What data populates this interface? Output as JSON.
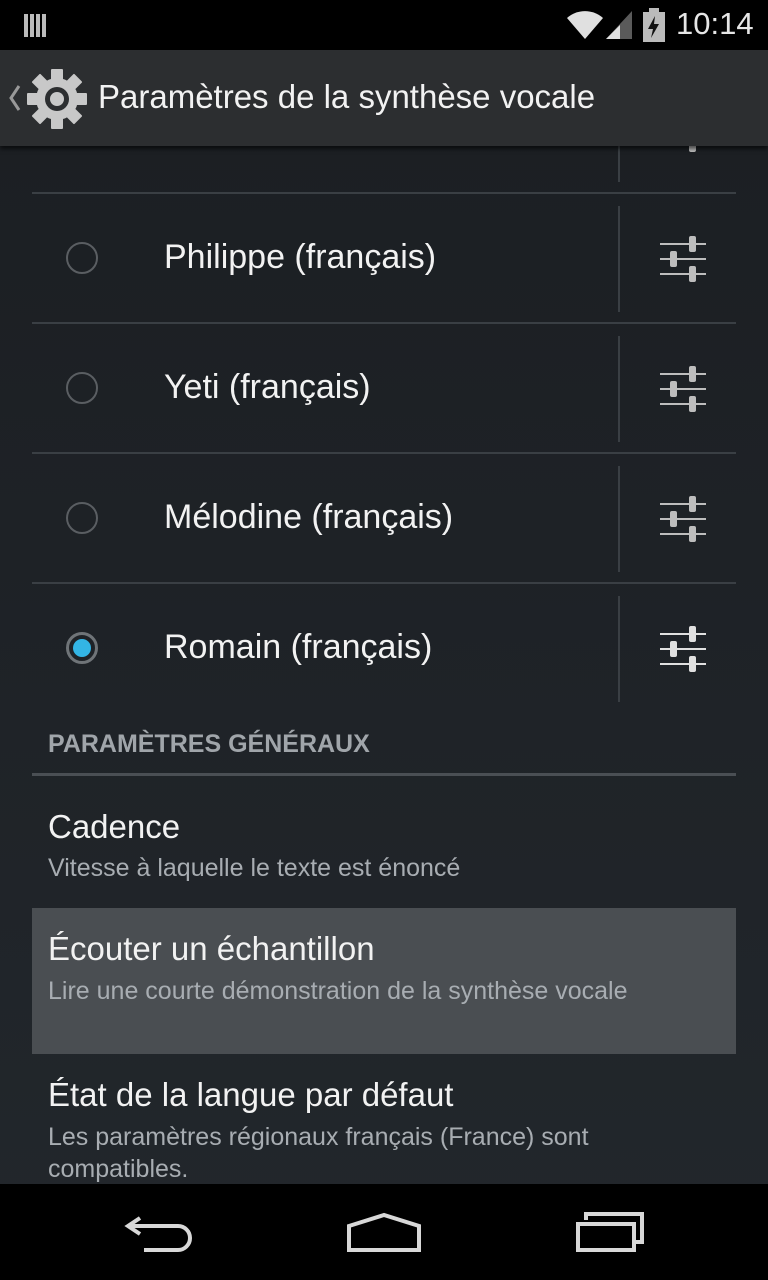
{
  "status_bar": {
    "time": "10:14",
    "icons": [
      "notification-icon",
      "wifi-icon",
      "cell-signal-icon",
      "battery-charging-icon"
    ]
  },
  "action_bar": {
    "title": "Paramètres de la synthèse vocale",
    "icons": [
      "back-caret-icon",
      "settings-gear-icon"
    ]
  },
  "voices": [
    {
      "label": "Philippe (français)",
      "selected": false
    },
    {
      "label": "Yeti (français)",
      "selected": false
    },
    {
      "label": "Mélodine (français)",
      "selected": false
    },
    {
      "label": "Romain (français)",
      "selected": true
    }
  ],
  "general": {
    "header": "PARAMÈTRES GÉNÉRAUX",
    "items": [
      {
        "title": "Cadence",
        "summary": "Vitesse à laquelle le texte est énoncé"
      },
      {
        "title": "Écouter un échantillon",
        "summary": "Lire une courte démonstration de la synthèse vocale"
      },
      {
        "title": "État de la langue par défaut",
        "summary": "Les paramètres régionaux français (France) sont compatibles."
      }
    ]
  },
  "nav_bar": {
    "icons": [
      "back-icon",
      "home-icon",
      "recent-apps-icon"
    ]
  },
  "colors": {
    "accent": "#33b5e5",
    "background": "#1f2327",
    "action_bar": "#2c2e30",
    "pressed": "#4a4e52"
  }
}
